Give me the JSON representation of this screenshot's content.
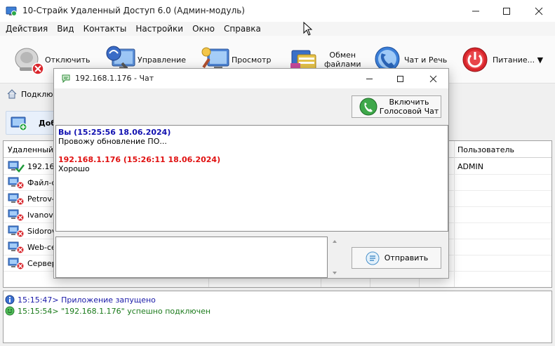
{
  "window": {
    "title": "10-Страйк Удаленный Доступ 6.0 (Админ-модуль)"
  },
  "menu": [
    "Действия",
    "Вид",
    "Контакты",
    "Настройки",
    "Окно",
    "Справка"
  ],
  "toolbar": {
    "disconnect": "Отключить",
    "control": "Управление",
    "view": "Просмотр",
    "files_line1": "Обмен",
    "files_line2": "файлами",
    "chat": "Чат и Речь",
    "power": "Питание... ▼"
  },
  "subbar": {
    "connections_label": "Подклю",
    "add_label": "Доб"
  },
  "table": {
    "col_name": "Удаленный П",
    "col_user": "Пользователь",
    "rows": [
      {
        "name": "192.168",
        "user": "ADMIN",
        "status": "connected"
      },
      {
        "name": "Файл-се",
        "user": "",
        "status": "offline"
      },
      {
        "name": "Petrov-P",
        "user": "",
        "status": "offline"
      },
      {
        "name": "Ivanov-",
        "user": "",
        "status": "offline"
      },
      {
        "name": "Sidorov-",
        "user": "",
        "status": "offline"
      },
      {
        "name": "Web-сер",
        "user": "",
        "status": "offline"
      },
      {
        "name": "Сервер",
        "user": "",
        "status": "offline"
      }
    ]
  },
  "log": [
    {
      "text": "15:15:47> Приложение запущено",
      "color": "#1a1aa8",
      "icon": "info-icon"
    },
    {
      "text": "15:15:54> \"192.168.1.176\" успешно подключен",
      "color": "#1a7a1a",
      "icon": "smile-icon"
    }
  ],
  "chat": {
    "title": "192.168.1.176 - Чат",
    "voice_line1": "Включить",
    "voice_line2": "Голосовой Чат",
    "messages": [
      {
        "head": "Вы (15:25:56 18.06.2024)",
        "body": "Провожу обновление ПО...",
        "color": "#1010b0"
      },
      {
        "head": "192.168.1.176 (15:26:11 18.06.2024)",
        "body": "Хорошо",
        "color": "#e01010"
      }
    ],
    "send_label": "Отправить"
  },
  "colors": {
    "accent_blue": "#1010b0",
    "accent_red": "#e01010",
    "power_red": "#d9262c"
  }
}
